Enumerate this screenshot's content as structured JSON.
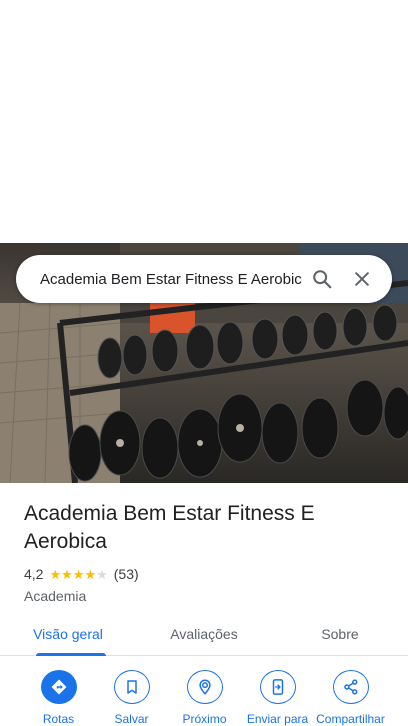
{
  "search": {
    "query": "Academia Bem Estar Fitness E Aerobica"
  },
  "place": {
    "title": "Academia Bem Estar Fitness E Aerobica",
    "rating": "4,2",
    "rating_value": 4.2,
    "stars_max": 5,
    "reviews_count": "(53)",
    "category": "Academia"
  },
  "tabs": [
    {
      "label": "Visão geral",
      "active": true
    },
    {
      "label": "Avaliações",
      "active": false
    },
    {
      "label": "Sobre",
      "active": false
    }
  ],
  "actions": [
    {
      "label": "Rotas",
      "icon": "directions-icon"
    },
    {
      "label": "Salvar",
      "icon": "bookmark-icon"
    },
    {
      "label": "Próximo",
      "icon": "nearby-icon"
    },
    {
      "label": "Enviar para",
      "icon": "send-to-phone-icon"
    },
    {
      "label": "Compartilhar",
      "icon": "share-icon"
    }
  ],
  "colors": {
    "accent": "#1a73e8",
    "star": "#fbbc04",
    "star_empty": "#dadce0"
  }
}
